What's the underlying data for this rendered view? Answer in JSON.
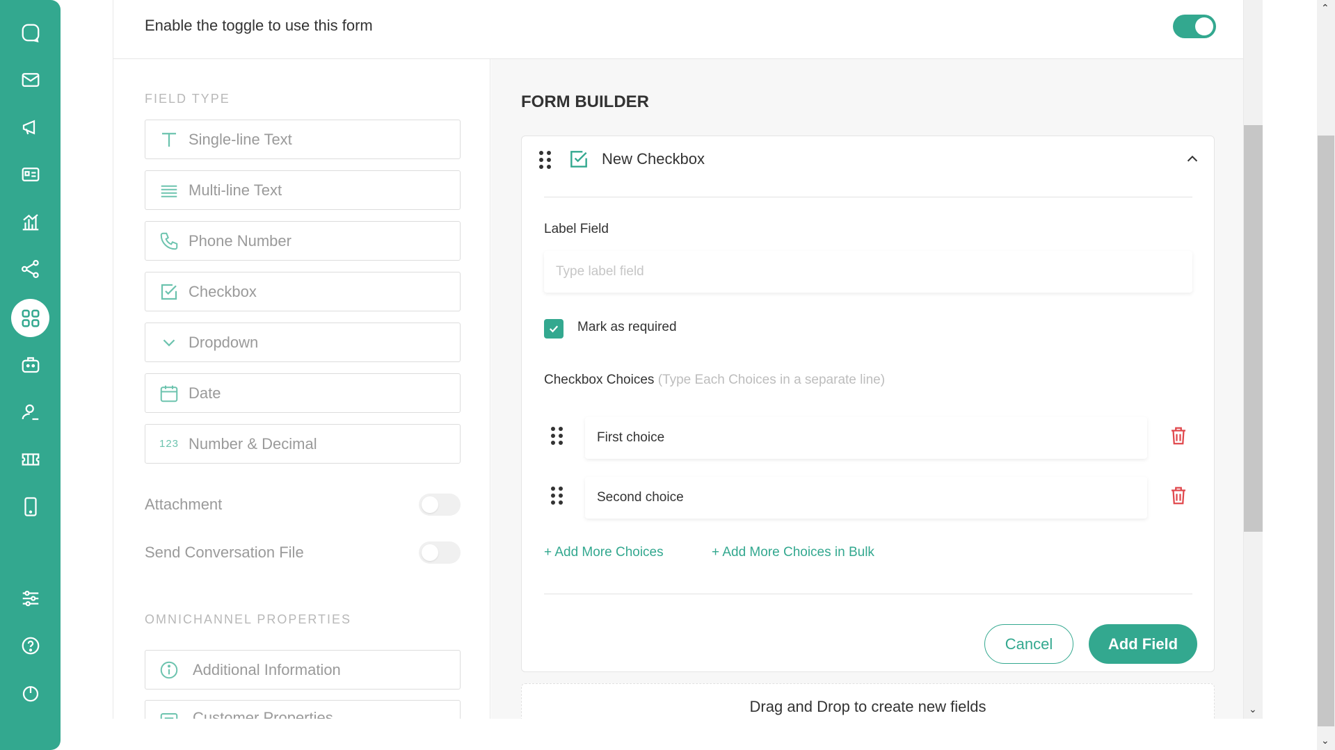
{
  "nav": {
    "items": [
      {
        "icon": "chat-icon"
      },
      {
        "icon": "mail-icon"
      },
      {
        "icon": "megaphone-icon"
      },
      {
        "icon": "contact-card-icon"
      },
      {
        "icon": "analytics-icon"
      },
      {
        "icon": "share-icon"
      },
      {
        "icon": "apps-grid-icon",
        "active": true
      },
      {
        "icon": "bot-icon"
      },
      {
        "icon": "agent-icon"
      },
      {
        "icon": "ticket-icon"
      },
      {
        "icon": "mobile-icon"
      },
      {
        "icon": "settings-sliders-icon"
      },
      {
        "icon": "help-icon"
      },
      {
        "icon": "power-icon"
      }
    ]
  },
  "topbar": {
    "text": "Enable the toggle to use this form",
    "toggle_on": true
  },
  "left": {
    "field_type_title": "FIELD TYPE",
    "field_types": [
      {
        "label": "Single-line Text",
        "icon": "text-icon"
      },
      {
        "label": "Multi-line Text",
        "icon": "lines-icon"
      },
      {
        "label": "Phone Number",
        "icon": "phone-icon"
      },
      {
        "label": "Checkbox",
        "icon": "checkbox-icon"
      },
      {
        "label": "Dropdown",
        "icon": "chevron-down-icon"
      },
      {
        "label": "Date",
        "icon": "calendar-icon"
      },
      {
        "label": "Number & Decimal",
        "icon": "number-icon",
        "icon_text": "123"
      }
    ],
    "toggles": [
      {
        "label": "Attachment",
        "on": false
      },
      {
        "label": "Send Conversation File",
        "on": false
      }
    ],
    "omni_title": "OMNICHANNEL PROPERTIES",
    "omni_fields": [
      {
        "label": "Additional Information",
        "icon": "info-icon"
      },
      {
        "label": "Customer Properties",
        "icon": "list-icon"
      }
    ]
  },
  "right": {
    "title": "FORM BUILDER",
    "card": {
      "title": "New Checkbox",
      "label_field_label": "Label Field",
      "label_field_placeholder": "Type label field",
      "required_label": "Mark as required",
      "required_checked": true,
      "choices_label": "Checkbox Choices",
      "choices_hint": "(Type Each Choices in a separate line)",
      "choices": [
        "First choice",
        "Second choice"
      ],
      "add_more": "+ Add More Choices",
      "add_bulk": "+ Add More Choices in Bulk",
      "cancel": "Cancel",
      "add_field": "Add Field"
    },
    "dropzone": "Drag and Drop to create new fields"
  },
  "colors": {
    "accent": "#33a88f",
    "danger": "#e0474c"
  }
}
